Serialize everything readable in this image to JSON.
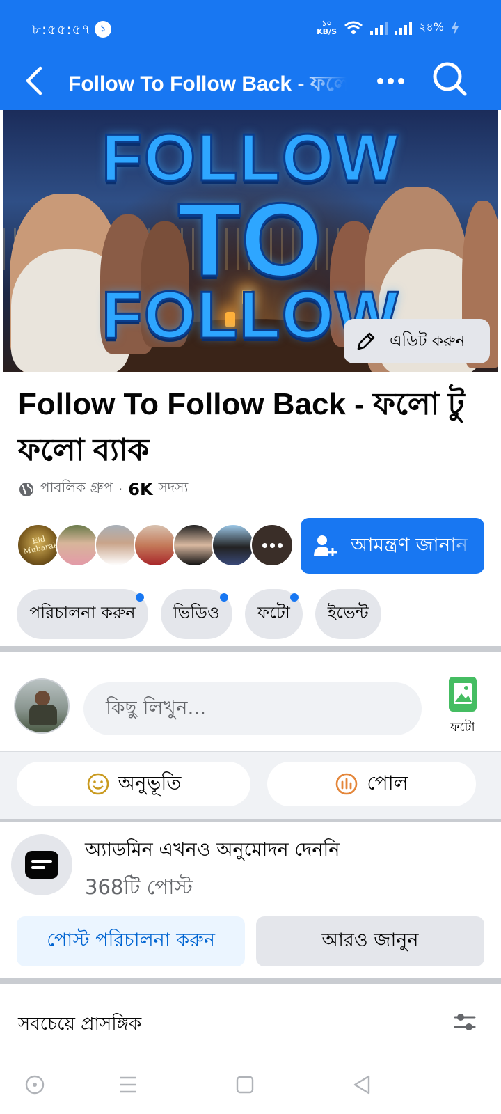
{
  "status_bar": {
    "time": "৮:৫৫:৫৭",
    "notification_count": "১",
    "net_speed_value": "১০",
    "net_speed_unit": "KB/S",
    "battery": "২৪%"
  },
  "nav": {
    "title": "Follow To Follow Back - ফলো টু ফলো ব্যাক",
    "back_icon": "arrow-left-icon",
    "more_icon": "more-horizontal-icon",
    "search_icon": "search-icon"
  },
  "cover": {
    "banner_word_1": "FOLLOW",
    "banner_word_2": "TO",
    "banner_word_3": "FOLLOW",
    "edit_label": "এডিট করুন"
  },
  "group": {
    "name": "Follow To Follow Back - ফলো টু ফলো ব্যাক",
    "privacy": "পাবলিক গ্রুপ",
    "separator": "·",
    "member_count": "6K",
    "member_label": "সদস্য",
    "invite_label": "আমন্ত্রণ জানান",
    "first_avatar_text": "Eid Mubarak"
  },
  "chips": [
    {
      "label": "পরিচালনা করুন",
      "badge": true
    },
    {
      "label": "ভিডিও",
      "badge": true
    },
    {
      "label": "ফটো",
      "badge": true
    },
    {
      "label": "ইভেন্ট",
      "badge": false
    }
  ],
  "composer": {
    "placeholder": "কিছু লিখুন...",
    "photo_label": "ফটো",
    "feeling_label": "অনুভূতি",
    "poll_label": "পোল"
  },
  "admin_notice": {
    "title": "অ্যাডমিন এখনও অনুমোদন দেননি",
    "post_count": "368টি পোস্ট",
    "manage_label": "পোস্ট পরিচালনা করুন",
    "learn_label": "আরও জানুন"
  },
  "feed": {
    "sort_label": "সবচেয়ে প্রাসঙ্গিক"
  },
  "colors": {
    "brand": "#1877f2",
    "chip_bg": "#e4e6eb",
    "photo_green": "#45bd62",
    "feeling_yellow": "#c99a1f",
    "poll_orange": "#e4863a"
  }
}
